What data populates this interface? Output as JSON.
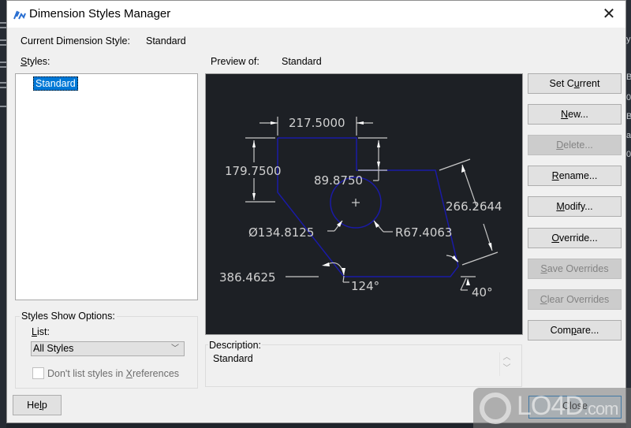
{
  "window": {
    "title": "Dimension Styles Manager",
    "close_icon": "close-icon"
  },
  "current_style": {
    "label": "Current Dimension Style:",
    "value": "Standard"
  },
  "styles": {
    "label": "Styles:",
    "items": [
      {
        "name": "Standard",
        "selected": true
      }
    ]
  },
  "preview": {
    "label": "Preview of:",
    "value": "Standard",
    "dimensions": {
      "top_linear": "217.5000",
      "left_linear": "179.7500",
      "step_linear": "89.8750",
      "aligned": "266.2644",
      "diameter": "Ø134.8125",
      "radius": "R67.4063",
      "ordinate": "386.4625",
      "angle_1": "124°",
      "angle_2": "40°"
    },
    "colors": {
      "background": "#1d2025",
      "geometry": "#1a1aa6",
      "dimension": "#d0d0d0"
    }
  },
  "show_options": {
    "title": "Styles Show Options:",
    "list_label": "List:",
    "list_selected": "All Styles",
    "xref_checkbox_label": "Don't list styles in Xreferences",
    "xref_checked": false
  },
  "description": {
    "label": "Description:",
    "text": "Standard"
  },
  "buttons": {
    "set_current": "Set Current",
    "new": "New...",
    "delete": "Delete...",
    "rename": "Rename...",
    "modify": "Modify...",
    "override": "Override...",
    "save_overrides": "Save Overrides",
    "clear_overrides": "Clear Overrides",
    "compare": "Compare...",
    "help": "Help",
    "close": "Close"
  },
  "watermark": {
    "text": "LO4D",
    "suffix": ".com"
  },
  "background_app": {
    "right_edge_text": [
      "y",
      "B",
      "0",
      "B",
      "a",
      "0"
    ]
  }
}
